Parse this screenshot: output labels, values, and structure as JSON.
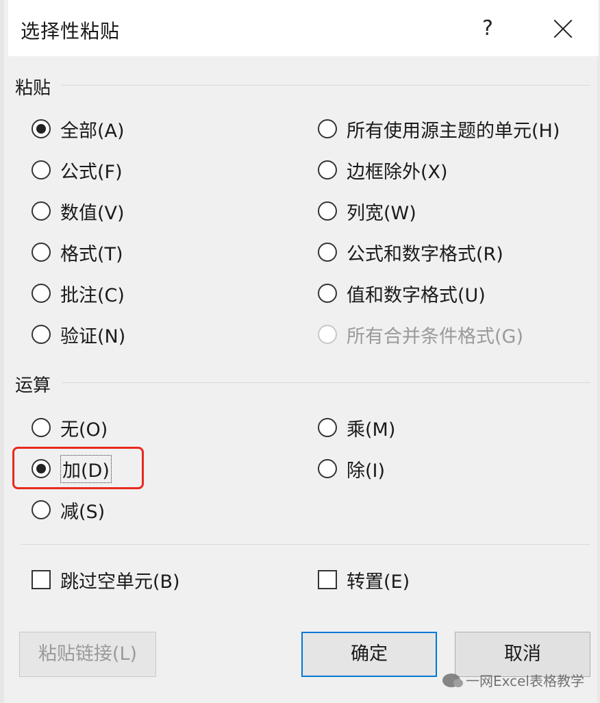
{
  "window": {
    "title": "选择性粘贴",
    "help_label": "?"
  },
  "paste": {
    "group_label": "粘贴",
    "options_left": [
      {
        "label": "全部(A)",
        "selected": true
      },
      {
        "label": "公式(F)",
        "selected": false
      },
      {
        "label": "数值(V)",
        "selected": false
      },
      {
        "label": "格式(T)",
        "selected": false
      },
      {
        "label": "批注(C)",
        "selected": false
      },
      {
        "label": "验证(N)",
        "selected": false
      }
    ],
    "options_right": [
      {
        "label": "所有使用源主题的单元(H)",
        "selected": false
      },
      {
        "label": "边框除外(X)",
        "selected": false
      },
      {
        "label": "列宽(W)",
        "selected": false
      },
      {
        "label": "公式和数字格式(R)",
        "selected": false
      },
      {
        "label": "值和数字格式(U)",
        "selected": false
      },
      {
        "label": "所有合并条件格式(G)",
        "selected": false,
        "disabled": true
      }
    ]
  },
  "operation": {
    "group_label": "运算",
    "options_left": [
      {
        "label": "无(O)",
        "selected": false
      },
      {
        "label": "加(D)",
        "selected": true
      },
      {
        "label": "减(S)",
        "selected": false
      }
    ],
    "options_right": [
      {
        "label": "乘(M)",
        "selected": false
      },
      {
        "label": "除(I)",
        "selected": false
      }
    ]
  },
  "checkboxes": {
    "skip_blanks": {
      "label": "跳过空单元(B)",
      "checked": false
    },
    "transpose": {
      "label": "转置(E)",
      "checked": false
    }
  },
  "buttons": {
    "paste_link": "粘贴链接(L)",
    "ok": "确定",
    "cancel": "取消"
  },
  "watermark": "一网Excel表格教学",
  "colors": {
    "highlight_border": "#e8291c",
    "default_button_border": "#0078d7"
  }
}
